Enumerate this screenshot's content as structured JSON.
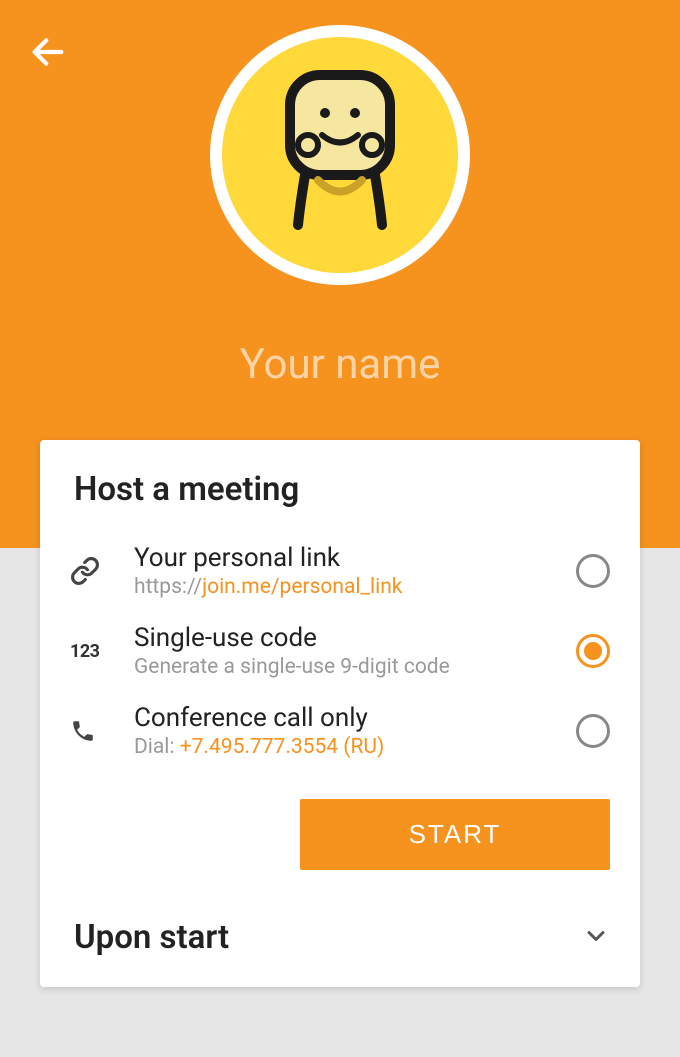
{
  "header": {
    "name_placeholder": "Your name"
  },
  "card": {
    "title": "Host a meeting",
    "options": [
      {
        "label": "Your personal link",
        "sub_prefix": "https://",
        "sub_accent": "join.me/personal_link",
        "selected": false
      },
      {
        "label": "Single-use code",
        "sub_plain": "Generate a single-use 9-digit code",
        "selected": true
      },
      {
        "label": "Conference call only",
        "sub_prefix": "Dial: ",
        "sub_accent": "+7.495.777.3554 (RU)",
        "selected": false
      }
    ],
    "start_button": "START",
    "upon_start_label": "Upon start"
  },
  "icons": {
    "number_icon": "123"
  }
}
